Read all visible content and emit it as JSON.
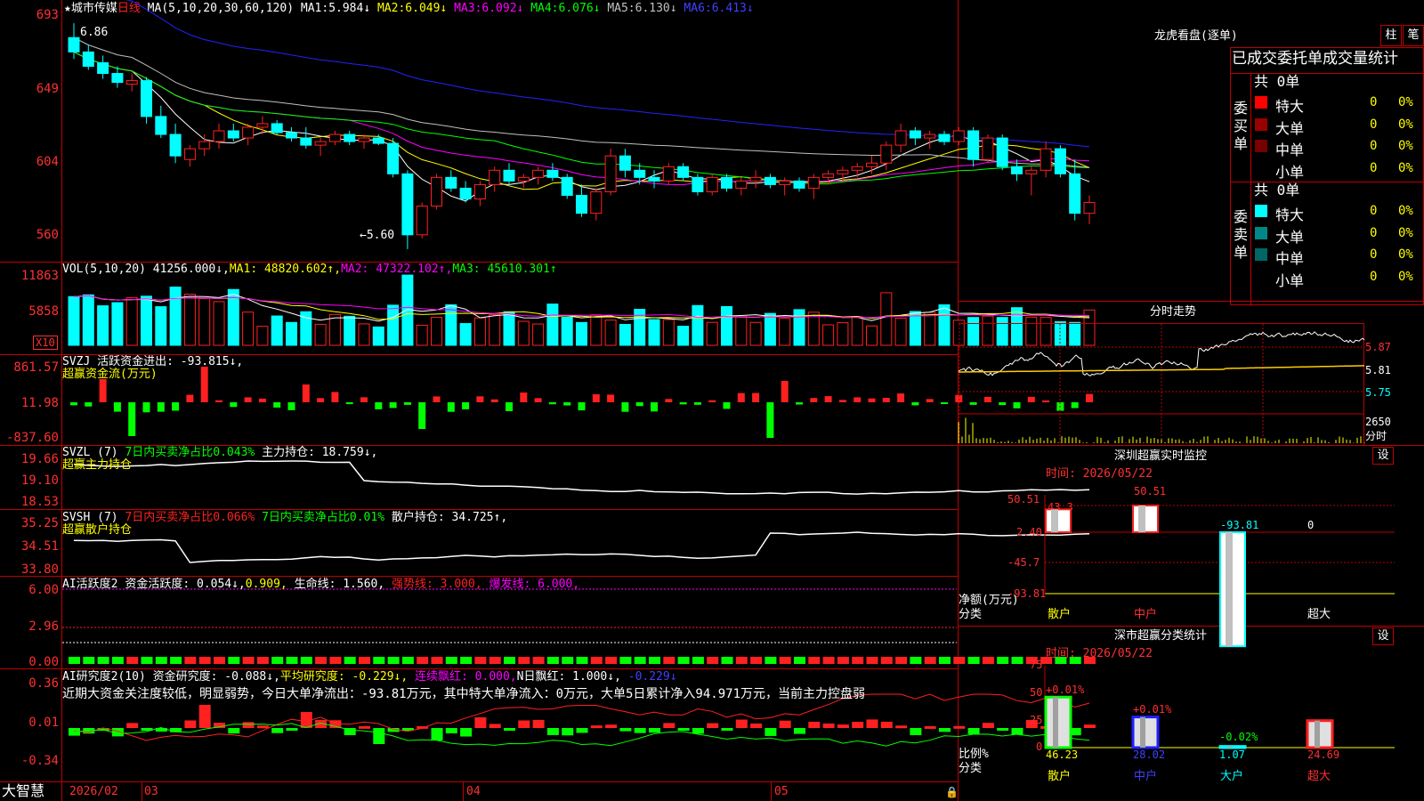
{
  "colors": {
    "up": "#ff2020",
    "down": "#00ffff",
    "grid": "#c00000",
    "axis": "#ff3030",
    "ma1": "#ffffff",
    "ma2": "#ffff00",
    "ma3": "#ff00ff",
    "ma4": "#00ff00",
    "ma5": "#c0c0c0",
    "ma6": "#2222ff"
  },
  "stock": {
    "name": "★城市传媒",
    "period": "日线",
    "ma_label": "MA(5,10,20,30,60,120)"
  },
  "main": {
    "ma": [
      {
        "name": "MA1:",
        "value": "5.984↓"
      },
      {
        "name": "MA2:",
        "value": "6.049↓"
      },
      {
        "name": "MA3:",
        "value": "6.092↓"
      },
      {
        "name": "MA4:",
        "value": "6.076↓"
      },
      {
        "name": "MA5:",
        "value": "6.130↓"
      },
      {
        "name": "MA6:",
        "value": "6.413↓"
      }
    ],
    "y_ticks": [
      "693",
      "649",
      "604",
      "560"
    ],
    "high_label": "6.86",
    "low_label": "←5.60"
  },
  "vol": {
    "label": "VOL(5,10,20)",
    "value": "41256.000↓,",
    "ma1": "MA1: 48820.602↑,",
    "ma2": "MA2: 47322.102↑,",
    "ma3": "MA3: 45610.301↑",
    "y_ticks": [
      "11863",
      "5858"
    ],
    "unit": "X10"
  },
  "svzj": {
    "label": "SVZJ  活跃资金进出: -93.815↓,",
    "sub": "超赢资金流(万元)",
    "y_ticks": [
      "861.57",
      "11.98",
      "-837.60"
    ]
  },
  "svzl": {
    "label": "SVZL (7)",
    "part1": "7日内买卖净占比0.043%",
    "part2": "主力持仓: 18.759↓,",
    "sub": "超赢主力持仓",
    "y_ticks": [
      "19.66",
      "19.10",
      "18.53"
    ]
  },
  "svsh": {
    "label": "SVSH (7)",
    "part1": "7日内买卖净占比0.066%",
    "part2": "7日内买卖净占比0.01%",
    "part3": "散户持仓: 34.725↑,",
    "sub": "超赢散户持仓",
    "y_ticks": [
      "35.25",
      "34.51",
      "33.80"
    ]
  },
  "ai1": {
    "label": "AI活跃度2",
    "part1": "资金活跃度: 0.054↓,",
    "part2": "0.909,",
    "part3": "生命线: 1.560,",
    "part4": "强势线: 3.000,",
    "part5": "爆发线: 6.000,",
    "y_ticks": [
      "6.00",
      "2.96",
      "0.00"
    ]
  },
  "ai2": {
    "label": "AI研究度2(10)",
    "part1": "资金研究度: -0.088↓,",
    "part2": "平均研究度: -0.229↓,",
    "part3": "连续飘红: 0.000,",
    "part4": "N日飘红: 1.000↓,",
    "part5": "-0.229↓",
    "text": "近期大资金关注度较低，明显弱势，今日大单净流出：-93.81万元，其中特大单净流入：0万元，大单5日累计净入94.971万元，当前主力控盘弱",
    "y_ticks": [
      "0.36",
      "0.01",
      "-0.34"
    ]
  },
  "xaxis": {
    "brand": "大智慧",
    "labels": [
      "2026/02",
      "03",
      "04",
      "05"
    ]
  },
  "right": {
    "title": "龙虎看盘(逐单)",
    "btn_bar": "柱",
    "btn_pen": "笔",
    "stat_title": "已成交委托单成交量统计",
    "buy_label": "委买单",
    "sell_label": "委卖单",
    "buy_total": "共 0单",
    "sell_total": "共 0单",
    "buy_rows": [
      {
        "name": "特大",
        "count": "0",
        "pct": "0%"
      },
      {
        "name": "大单",
        "count": "0",
        "pct": "0%"
      },
      {
        "name": "中单",
        "count": "0",
        "pct": "0%"
      },
      {
        "name": "小单",
        "count": "0",
        "pct": "0%"
      }
    ],
    "sell_rows": [
      {
        "name": "特大",
        "count": "0",
        "pct": "0%"
      },
      {
        "name": "大单",
        "count": "0",
        "pct": "0%"
      },
      {
        "name": "中单",
        "count": "0",
        "pct": "0%"
      },
      {
        "name": "小单",
        "count": "0",
        "pct": "0%"
      }
    ],
    "buy_colors": [
      "#ff0000",
      "#990000",
      "#770000",
      "#000000"
    ],
    "sell_colors": [
      "#00ffff",
      "#008888",
      "#006666",
      "#000000"
    ],
    "intraday_title": "分时走势",
    "intraday_y": [
      "5.87",
      "5.81",
      "5.75"
    ],
    "intraday_vol": "2650",
    "intraday_unit": "分时",
    "sz_title": "深圳超赢实时监控",
    "sz_set": "设",
    "sz_time": "时间: 2026/05/22",
    "sz_y": [
      "50.51",
      "2.40",
      "-45.7",
      "-93.81"
    ],
    "sz_ylabel": "净额(万元)",
    "sz_xlabel": "分类",
    "sz_cats": [
      "散户",
      "中户",
      "大户",
      "超大"
    ],
    "sz_vals": [
      "43.3",
      "50.51",
      "-93.81",
      "0"
    ],
    "sc_title": "深市超赢分类统计",
    "sc_set": "设",
    "sc_time": "时间: 2026/05/22",
    "sc_y": [
      "75",
      "50",
      "25",
      "0"
    ],
    "sc_ylabel": "比例%",
    "sc_xlabel": "分类",
    "sc_top": [
      "+0.01%",
      "+0.01%",
      "-0.02%",
      ""
    ],
    "sc_bot": [
      "46.23",
      "28.02",
      "1.07",
      "24.69"
    ],
    "sc_cats": [
      "散户",
      "中户",
      "大户",
      "超大"
    ]
  },
  "chart_data": [
    {
      "type": "candlestick",
      "title": "城市传媒 日线",
      "ylim": [
        5.55,
        6.95
      ],
      "x_labels": [
        "2026/02",
        "03",
        "04",
        "05"
      ],
      "ohlc": [
        [
          6.78,
          6.86,
          6.66,
          6.7
        ],
        [
          6.7,
          6.74,
          6.6,
          6.62
        ],
        [
          6.64,
          6.68,
          6.55,
          6.58
        ],
        [
          6.58,
          6.62,
          6.5,
          6.53
        ],
        [
          6.52,
          6.58,
          6.48,
          6.54
        ],
        [
          6.54,
          6.56,
          6.3,
          6.34
        ],
        [
          6.34,
          6.4,
          6.22,
          6.24
        ],
        [
          6.24,
          6.3,
          6.08,
          6.12
        ],
        [
          6.1,
          6.18,
          6.06,
          6.16
        ],
        [
          6.16,
          6.24,
          6.12,
          6.2
        ],
        [
          6.2,
          6.3,
          6.16,
          6.26
        ],
        [
          6.26,
          6.3,
          6.2,
          6.22
        ],
        [
          6.22,
          6.3,
          6.18,
          6.28
        ],
        [
          6.28,
          6.34,
          6.24,
          6.3
        ],
        [
          6.3,
          6.32,
          6.24,
          6.25
        ],
        [
          6.25,
          6.28,
          6.2,
          6.22
        ],
        [
          6.22,
          6.28,
          6.16,
          6.18
        ],
        [
          6.18,
          6.22,
          6.12,
          6.2
        ],
        [
          6.2,
          6.26,
          6.18,
          6.24
        ],
        [
          6.24,
          6.26,
          6.18,
          6.2
        ],
        [
          6.2,
          6.24,
          6.16,
          6.22
        ],
        [
          6.22,
          6.24,
          6.18,
          6.19
        ],
        [
          6.19,
          6.22,
          6.0,
          6.02
        ],
        [
          6.02,
          6.04,
          5.6,
          5.68
        ],
        [
          5.68,
          5.86,
          5.66,
          5.84
        ],
        [
          5.84,
          6.02,
          5.82,
          6.0
        ],
        [
          6.0,
          6.04,
          5.92,
          5.94
        ],
        [
          5.94,
          5.98,
          5.86,
          5.88
        ],
        [
          5.88,
          5.98,
          5.84,
          5.96
        ],
        [
          5.96,
          6.06,
          5.92,
          6.04
        ],
        [
          6.04,
          6.08,
          5.96,
          5.98
        ],
        [
          5.98,
          6.02,
          5.94,
          6.0
        ],
        [
          6.0,
          6.06,
          5.96,
          6.04
        ],
        [
          6.04,
          6.08,
          5.98,
          6.0
        ],
        [
          6.0,
          6.02,
          5.88,
          5.9
        ],
        [
          5.9,
          5.96,
          5.78,
          5.8
        ],
        [
          5.8,
          5.94,
          5.76,
          5.92
        ],
        [
          5.92,
          6.16,
          5.9,
          6.12
        ],
        [
          6.12,
          6.16,
          6.0,
          6.04
        ],
        [
          6.04,
          6.08,
          5.96,
          6.0
        ],
        [
          6.0,
          6.04,
          5.94,
          5.98
        ],
        [
          5.98,
          6.08,
          5.96,
          6.06
        ],
        [
          6.06,
          6.08,
          5.98,
          6.0
        ],
        [
          6.0,
          6.02,
          5.9,
          5.92
        ],
        [
          5.92,
          6.02,
          5.9,
          6.0
        ],
        [
          6.0,
          6.02,
          5.92,
          5.94
        ],
        [
          5.94,
          6.0,
          5.9,
          5.98
        ],
        [
          5.98,
          6.04,
          5.94,
          6.0
        ],
        [
          6.0,
          6.02,
          5.94,
          5.96
        ],
        [
          5.96,
          6.0,
          5.9,
          5.98
        ],
        [
          5.98,
          6.0,
          5.92,
          5.94
        ],
        [
          5.94,
          6.02,
          5.88,
          6.0
        ],
        [
          6.0,
          6.04,
          5.96,
          6.02
        ],
        [
          6.02,
          6.06,
          5.98,
          6.04
        ],
        [
          6.04,
          6.08,
          6.0,
          6.06
        ],
        [
          6.06,
          6.12,
          6.02,
          6.08
        ],
        [
          6.08,
          6.2,
          6.04,
          6.18
        ],
        [
          6.18,
          6.3,
          6.14,
          6.26
        ],
        [
          6.26,
          6.28,
          6.18,
          6.22
        ],
        [
          6.22,
          6.26,
          6.16,
          6.24
        ],
        [
          6.24,
          6.26,
          6.18,
          6.2
        ],
        [
          6.2,
          6.28,
          6.18,
          6.26
        ],
        [
          6.26,
          6.28,
          6.06,
          6.1
        ],
        [
          6.1,
          6.24,
          6.08,
          6.22
        ],
        [
          6.22,
          6.24,
          6.04,
          6.06
        ],
        [
          6.06,
          6.1,
          5.98,
          6.02
        ],
        [
          6.02,
          6.06,
          5.9,
          6.04
        ],
        [
          6.04,
          6.2,
          6.0,
          6.16
        ],
        [
          6.16,
          6.18,
          6.0,
          6.02
        ],
        [
          6.02,
          6.1,
          5.76,
          5.8
        ],
        [
          5.8,
          5.9,
          5.74,
          5.86
        ]
      ]
    }
  ]
}
